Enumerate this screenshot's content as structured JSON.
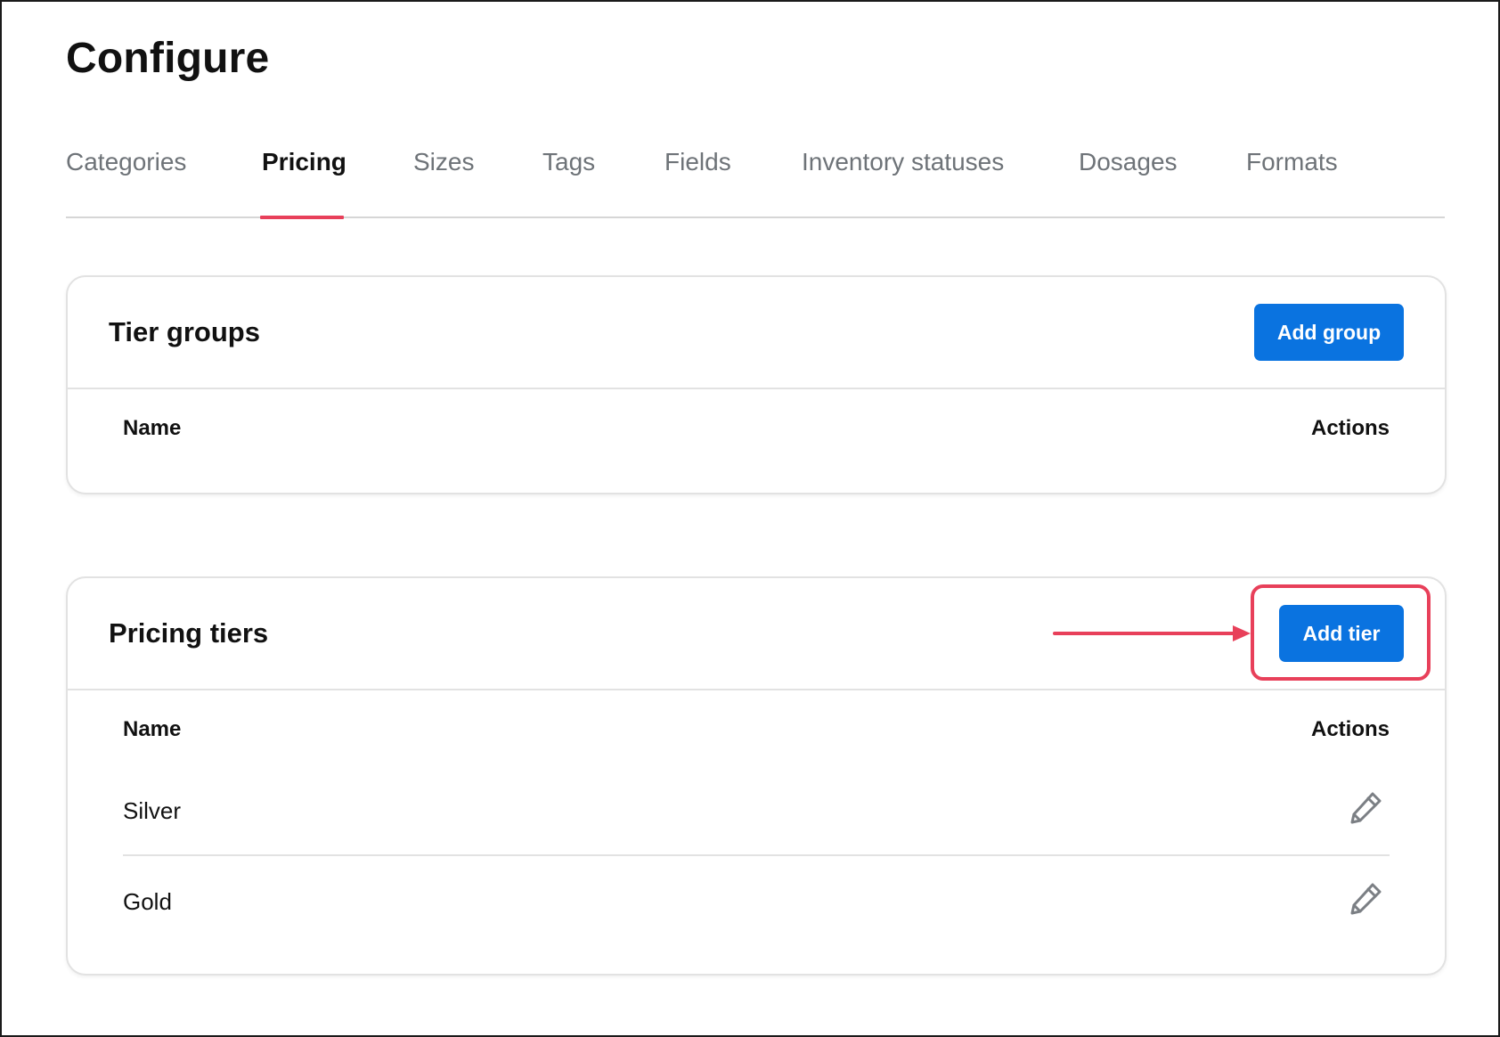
{
  "page": {
    "title": "Configure"
  },
  "tabs": [
    {
      "label": "Categories"
    },
    {
      "label": "Pricing"
    },
    {
      "label": "Sizes"
    },
    {
      "label": "Tags"
    },
    {
      "label": "Fields"
    },
    {
      "label": "Inventory statuses"
    },
    {
      "label": "Dosages"
    },
    {
      "label": "Formats"
    }
  ],
  "active_tab": "Pricing",
  "tier_groups": {
    "title": "Tier groups",
    "add_button_label": "Add group",
    "columns": {
      "name": "Name",
      "actions": "Actions"
    },
    "rows": []
  },
  "pricing_tiers": {
    "title": "Pricing tiers",
    "add_button_label": "Add tier",
    "columns": {
      "name": "Name",
      "actions": "Actions"
    },
    "rows": [
      {
        "name": "Silver",
        "action_icon": "pencil-icon"
      },
      {
        "name": "Gold",
        "action_icon": "pencil-icon"
      }
    ]
  },
  "colors": {
    "primary_button": "#0a73e0",
    "accent": "#e8405a",
    "tab_inactive": "#6e7378",
    "icon": "#7b7f84"
  },
  "annotations": {
    "highlight": "red rounded box around Add tier button",
    "arrow": "red arrow pointing to Add tier button"
  }
}
